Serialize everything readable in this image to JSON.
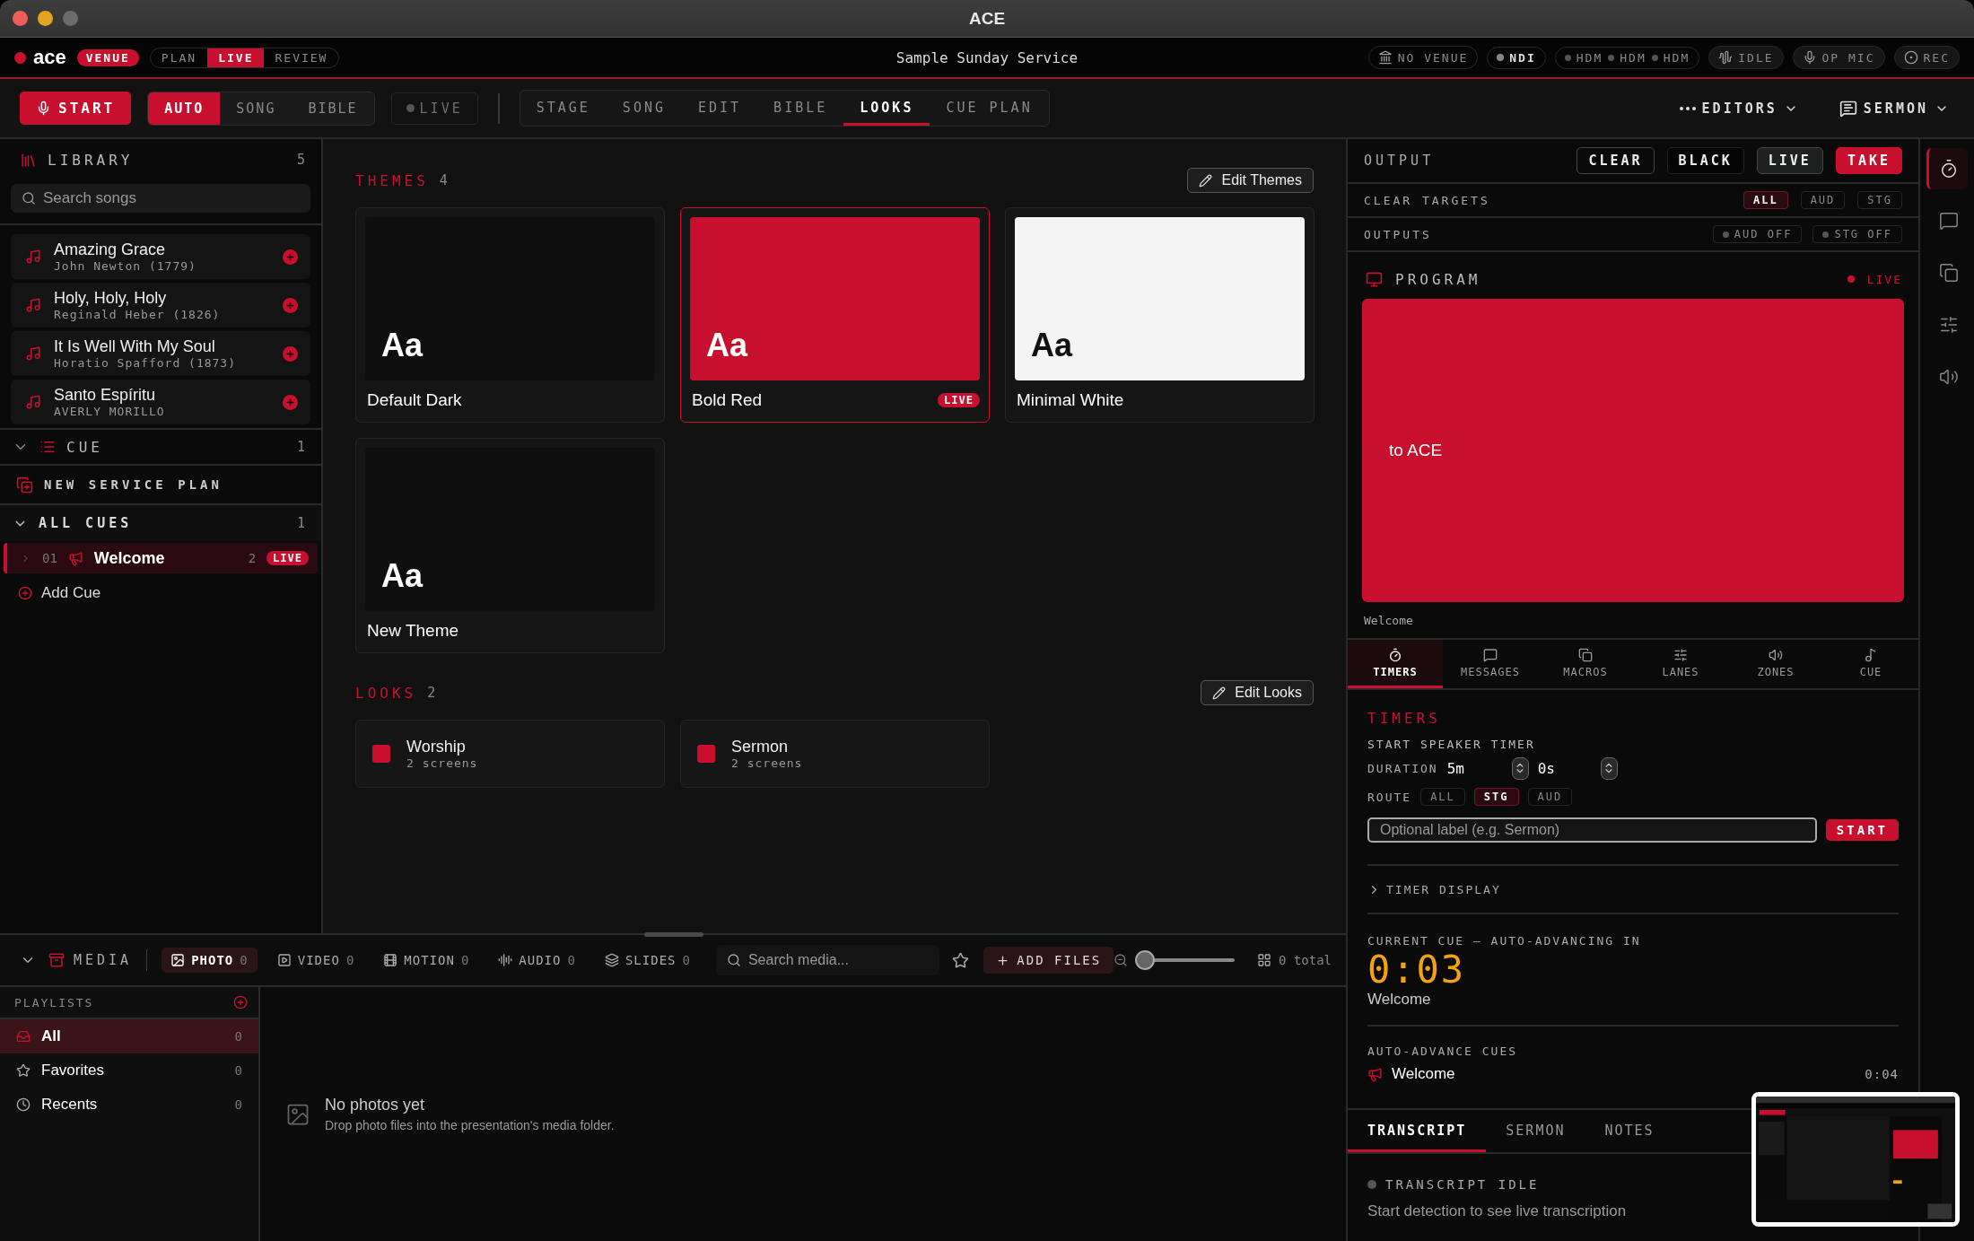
{
  "window": {
    "title": "ACE"
  },
  "topbar": {
    "logo": "ace",
    "venue_badge": "VENUE",
    "modes": [
      {
        "label": "PLAN",
        "selected": false
      },
      {
        "label": "LIVE",
        "selected": true
      },
      {
        "label": "REVIEW",
        "selected": false
      }
    ],
    "service": "Sample Sunday Service",
    "status": [
      {
        "kind": "venue",
        "label": "NO VENUE"
      },
      {
        "kind": "dot",
        "label": "NDI"
      },
      {
        "kind": "group",
        "items": [
          "HDM",
          "HDM",
          "HDM"
        ]
      },
      {
        "kind": "idle",
        "label": "IDLE"
      },
      {
        "kind": "mic",
        "label": "OP MIC"
      },
      {
        "kind": "rec",
        "label": "REC"
      }
    ]
  },
  "toolbar": {
    "start": "START",
    "modes": [
      {
        "label": "AUTO",
        "selected": true
      },
      {
        "label": "SONG",
        "selected": false
      },
      {
        "label": "BIBLE",
        "selected": false
      }
    ],
    "live": "LIVE",
    "views": [
      {
        "label": "STAGE",
        "selected": false
      },
      {
        "label": "SONG",
        "selected": false
      },
      {
        "label": "EDIT",
        "selected": false
      },
      {
        "label": "BIBLE",
        "selected": false
      },
      {
        "label": "LOOKS",
        "selected": true
      },
      {
        "label": "CUE PLAN",
        "selected": false
      }
    ],
    "editors": "EDITORS",
    "sermon": "SERMON"
  },
  "library": {
    "title": "LIBRARY",
    "count": "5",
    "search": {
      "placeholder": "Search songs"
    },
    "songs": [
      {
        "title": "Amazing Grace",
        "author": "John Newton (1779)"
      },
      {
        "title": "Holy, Holy, Holy",
        "author": "Reginald Heber (1826)"
      },
      {
        "title": "It Is Well With My Soul",
        "author": "Horatio Spafford (1873)"
      },
      {
        "title": "Santo Espíritu",
        "author": "AVERLY MORILLO"
      }
    ]
  },
  "cue": {
    "title": "CUE",
    "count": "1",
    "expanded": true
  },
  "new_plan": "NEW SERVICE PLAN",
  "all_cues": {
    "title": "ALL CUES",
    "count": "1",
    "expanded": true,
    "items": [
      {
        "number": "01",
        "name": "Welcome",
        "count": "2",
        "badge": "LIVE",
        "selected": true
      }
    ],
    "add": "Add Cue"
  },
  "themes": {
    "title": "THEMES",
    "count": "4",
    "edit": "Edit Themes",
    "items": [
      {
        "name": "Default Dark",
        "sample": "Aa",
        "color": "#0f0f0f",
        "selected": false
      },
      {
        "name": "Bold Red",
        "sample": "Aa",
        "color": "#c8102e",
        "selected": true,
        "badge": "LIVE"
      },
      {
        "name": "Minimal White",
        "sample": "Aa",
        "color": "#f4f4f4",
        "selected": false
      },
      {
        "name": "New Theme",
        "sample": "Aa",
        "color": "#0f0f0f",
        "selected": false
      }
    ]
  },
  "looks": {
    "title": "LOOKS",
    "count": "2",
    "edit": "Edit Looks",
    "items": [
      {
        "name": "Worship",
        "detail": "2 screens"
      },
      {
        "name": "Sermon",
        "detail": "2 screens"
      }
    ]
  },
  "media": {
    "title": "MEDIA",
    "tabs": [
      {
        "label": "PHOTO",
        "count": "0",
        "selected": true
      },
      {
        "kind": "video",
        "label": "VIDEO",
        "count": "0",
        "selected": false
      },
      {
        "kind": "motion",
        "label": "MOTION",
        "count": "0",
        "selected": false
      },
      {
        "kind": "audio",
        "label": "AUDIO",
        "count": "0",
        "selected": false
      },
      {
        "kind": "slides",
        "label": "SLIDES",
        "count": "0",
        "selected": false
      }
    ],
    "search": {
      "placeholder": "Search media..."
    },
    "add": "ADD FILES",
    "zoom": {
      "level": 0
    },
    "total": "0 total",
    "playlists": {
      "title": "PLAYLISTS",
      "items": [
        {
          "kind": "all",
          "name": "All",
          "count": "0",
          "selected": true
        },
        {
          "kind": "favorites",
          "name": "Favorites",
          "count": "0",
          "selected": false
        },
        {
          "kind": "recents",
          "name": "Recents",
          "count": "0",
          "selected": false
        }
      ]
    },
    "empty": {
      "title": "No photos yet",
      "detail": "Drop photo files into the presentation's media folder."
    }
  },
  "output": {
    "title": "OUTPUT",
    "buttons": [
      {
        "kind": "outline",
        "label": "CLEAR"
      },
      {
        "kind": "plain",
        "label": "BLACK"
      },
      {
        "kind": "grey",
        "label": "LIVE"
      },
      {
        "kind": "primary",
        "label": "TAKE"
      }
    ],
    "clear_targets": {
      "label": "CLEAR TARGETS",
      "options": [
        {
          "label": "ALL",
          "selected": true
        },
        {
          "label": "AUD",
          "selected": false
        },
        {
          "label": "STG",
          "selected": false
        }
      ]
    },
    "outputs": {
      "label": "OUTPUTS",
      "items": [
        {
          "label": "AUD OFF",
          "on": false
        },
        {
          "label": "STG OFF",
          "on": false
        }
      ]
    },
    "program": {
      "title": "PROGRAM",
      "status": "LIVE",
      "slide_text": "to ACE",
      "caption": "Welcome"
    }
  },
  "tools": {
    "tabs": [
      {
        "kind": "timers",
        "label": "TIMERS",
        "selected": true
      },
      {
        "kind": "messages",
        "label": "MESSAGES",
        "selected": false
      },
      {
        "kind": "macros",
        "label": "MACROS",
        "selected": false
      },
      {
        "kind": "lanes",
        "label": "LANES",
        "selected": false
      },
      {
        "kind": "zones",
        "label": "ZONES",
        "selected": false
      },
      {
        "kind": "cue",
        "label": "CUE",
        "selected": false
      }
    ]
  },
  "timers": {
    "title": "TIMERS",
    "subtitle": "START SPEAKER TIMER",
    "duration_label": "DURATION",
    "minutes": "5m",
    "seconds": "0s",
    "route_label": "ROUTE",
    "routes": [
      {
        "label": "ALL",
        "selected": false
      },
      {
        "label": "STG",
        "selected": true
      },
      {
        "label": "AUD",
        "selected": false
      }
    ],
    "label_field": {
      "placeholder": "Optional label (e.g. Sermon)"
    },
    "start": "START",
    "timer_display": {
      "label": "TIMER DISPLAY",
      "expanded": false
    },
    "current": {
      "label": "CURRENT CUE — AUTO-ADVANCING IN",
      "countdown": "0:03",
      "cue": "Welcome"
    },
    "auto_advance": {
      "label": "AUTO-ADVANCE CUES",
      "items": [
        {
          "name": "Welcome",
          "time": "0:04"
        }
      ]
    }
  },
  "notes": {
    "tabs": [
      {
        "label": "TRANSCRIPT",
        "selected": true
      },
      {
        "label": "SERMON",
        "selected": false
      },
      {
        "label": "NOTES",
        "selected": false
      }
    ],
    "status": "TRANSCRIPT IDLE",
    "hint": "Start detection to see live transcription"
  },
  "rail": [
    {
      "kind": "timers",
      "selected": true
    },
    {
      "kind": "messages",
      "selected": false
    },
    {
      "kind": "macros",
      "selected": false
    },
    {
      "kind": "lanes",
      "selected": false
    },
    {
      "kind": "zones",
      "selected": false
    }
  ]
}
